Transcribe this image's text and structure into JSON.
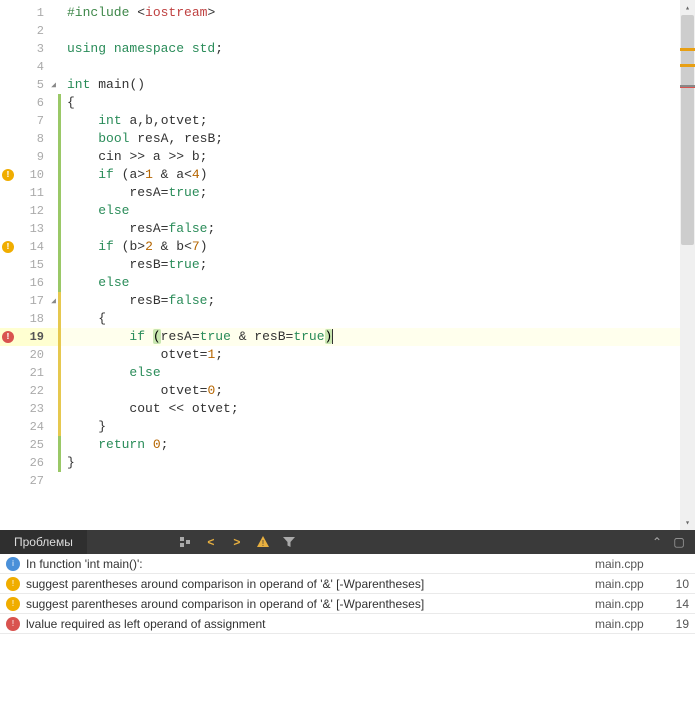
{
  "editor": {
    "lines": [
      {
        "n": 1,
        "segs": [
          [
            "pp",
            "#include "
          ],
          [
            "op",
            "<"
          ],
          [
            "ppval",
            "iostream"
          ],
          [
            "op",
            ">"
          ]
        ]
      },
      {
        "n": 2,
        "segs": []
      },
      {
        "n": 3,
        "segs": [
          [
            "kw",
            "using "
          ],
          [
            "kw",
            "namespace "
          ],
          [
            "type",
            "std"
          ],
          [
            "op",
            ";"
          ]
        ]
      },
      {
        "n": 4,
        "segs": []
      },
      {
        "n": 5,
        "segs": [
          [
            "type",
            "int "
          ],
          [
            "id",
            "main"
          ],
          [
            "op",
            "()"
          ]
        ],
        "fold": true
      },
      {
        "n": 6,
        "segs": [
          [
            "op",
            "{"
          ]
        ],
        "mod": "green"
      },
      {
        "n": 7,
        "segs": [
          [
            "id",
            "    "
          ],
          [
            "type",
            "int "
          ],
          [
            "id",
            "a"
          ],
          [
            "op",
            ","
          ],
          [
            "id",
            "b"
          ],
          [
            "op",
            ","
          ],
          [
            "id",
            "otvet"
          ],
          [
            "op",
            ";"
          ]
        ],
        "mod": "green"
      },
      {
        "n": 8,
        "segs": [
          [
            "id",
            "    "
          ],
          [
            "type",
            "bool "
          ],
          [
            "id",
            "resA"
          ],
          [
            "op",
            ", "
          ],
          [
            "id",
            "resB"
          ],
          [
            "op",
            ";"
          ]
        ],
        "mod": "green"
      },
      {
        "n": 9,
        "segs": [
          [
            "id",
            "    "
          ],
          [
            "id",
            "cin "
          ],
          [
            "op",
            ">> "
          ],
          [
            "id",
            "a "
          ],
          [
            "op",
            ">> "
          ],
          [
            "id",
            "b"
          ],
          [
            "op",
            ";"
          ]
        ],
        "mod": "green"
      },
      {
        "n": 10,
        "segs": [
          [
            "id",
            "    "
          ],
          [
            "kw",
            "if "
          ],
          [
            "op",
            "("
          ],
          [
            "id",
            "a"
          ],
          [
            "op",
            ">"
          ],
          [
            "num",
            "1"
          ],
          [
            "op",
            " & "
          ],
          [
            "id",
            "a"
          ],
          [
            "op",
            "<"
          ],
          [
            "num",
            "4"
          ],
          [
            "op",
            ")"
          ]
        ],
        "mod": "green",
        "gicon": "warn"
      },
      {
        "n": 11,
        "segs": [
          [
            "id",
            "        "
          ],
          [
            "id",
            "resA"
          ],
          [
            "op",
            "="
          ],
          [
            "bool",
            "true"
          ],
          [
            "op",
            ";"
          ]
        ],
        "mod": "green"
      },
      {
        "n": 12,
        "segs": [
          [
            "id",
            "    "
          ],
          [
            "kw",
            "else"
          ]
        ],
        "mod": "green"
      },
      {
        "n": 13,
        "segs": [
          [
            "id",
            "        "
          ],
          [
            "id",
            "resA"
          ],
          [
            "op",
            "="
          ],
          [
            "bool",
            "false"
          ],
          [
            "op",
            ";"
          ]
        ],
        "mod": "green"
      },
      {
        "n": 14,
        "segs": [
          [
            "id",
            "    "
          ],
          [
            "kw",
            "if "
          ],
          [
            "op",
            "("
          ],
          [
            "id",
            "b"
          ],
          [
            "op",
            ">"
          ],
          [
            "num",
            "2"
          ],
          [
            "op",
            " & "
          ],
          [
            "id",
            "b"
          ],
          [
            "op",
            "<"
          ],
          [
            "num",
            "7"
          ],
          [
            "op",
            ")"
          ]
        ],
        "mod": "green",
        "gicon": "warn"
      },
      {
        "n": 15,
        "segs": [
          [
            "id",
            "        "
          ],
          [
            "id",
            "resB"
          ],
          [
            "op",
            "="
          ],
          [
            "bool",
            "true"
          ],
          [
            "op",
            ";"
          ]
        ],
        "mod": "green"
      },
      {
        "n": 16,
        "segs": [
          [
            "id",
            "    "
          ],
          [
            "kw",
            "else"
          ]
        ],
        "mod": "green"
      },
      {
        "n": 17,
        "segs": [
          [
            "id",
            "        "
          ],
          [
            "id",
            "resB"
          ],
          [
            "op",
            "="
          ],
          [
            "bool",
            "false"
          ],
          [
            "op",
            ";"
          ]
        ],
        "mod": "yellow",
        "fold": true
      },
      {
        "n": 18,
        "segs": [
          [
            "id",
            "    "
          ],
          [
            "op",
            "{"
          ]
        ],
        "mod": "yellow"
      },
      {
        "n": 19,
        "segs": [
          [
            "id",
            "        "
          ],
          [
            "kw",
            "if "
          ],
          [
            "hp",
            "("
          ],
          [
            "id",
            "resA"
          ],
          [
            "op",
            "="
          ],
          [
            "bool",
            "true"
          ],
          [
            "op",
            " & "
          ],
          [
            "id",
            "resB"
          ],
          [
            "op",
            "="
          ],
          [
            "bool",
            "true"
          ],
          [
            "hp",
            ")"
          ],
          [
            "cur",
            "|"
          ]
        ],
        "mod": "yellow",
        "gicon": "err",
        "hl": true
      },
      {
        "n": 20,
        "segs": [
          [
            "id",
            "            "
          ],
          [
            "id",
            "otvet"
          ],
          [
            "op",
            "="
          ],
          [
            "num",
            "1"
          ],
          [
            "op",
            ";"
          ]
        ],
        "mod": "yellow"
      },
      {
        "n": 21,
        "segs": [
          [
            "id",
            "        "
          ],
          [
            "kw",
            "else"
          ]
        ],
        "mod": "yellow"
      },
      {
        "n": 22,
        "segs": [
          [
            "id",
            "            "
          ],
          [
            "id",
            "otvet"
          ],
          [
            "op",
            "="
          ],
          [
            "num",
            "0"
          ],
          [
            "op",
            ";"
          ]
        ],
        "mod": "yellow"
      },
      {
        "n": 23,
        "segs": [
          [
            "id",
            "        "
          ],
          [
            "id",
            "cout "
          ],
          [
            "op",
            "<< "
          ],
          [
            "id",
            "otvet"
          ],
          [
            "op",
            ";"
          ]
        ],
        "mod": "yellow"
      },
      {
        "n": 24,
        "segs": [
          [
            "id",
            "    "
          ],
          [
            "op",
            "}"
          ]
        ],
        "mod": "yellow"
      },
      {
        "n": 25,
        "segs": [
          [
            "id",
            "    "
          ],
          [
            "kw",
            "return "
          ],
          [
            "num",
            "0"
          ],
          [
            "op",
            ";"
          ]
        ],
        "mod": "green"
      },
      {
        "n": 26,
        "segs": [
          [
            "op",
            "}"
          ]
        ],
        "mod": "green"
      },
      {
        "n": 27,
        "segs": []
      }
    ]
  },
  "panel": {
    "tab": "Проблемы",
    "problems": [
      {
        "icon": "info",
        "msg": "In function 'int main()':",
        "file": "main.cpp",
        "line": ""
      },
      {
        "icon": "warn",
        "msg": "suggest parentheses around comparison in operand of '&' [-Wparentheses]",
        "file": "main.cpp",
        "line": "10"
      },
      {
        "icon": "warn",
        "msg": "suggest parentheses around comparison in operand of '&' [-Wparentheses]",
        "file": "main.cpp",
        "line": "14"
      },
      {
        "icon": "err",
        "msg": "lvalue required as left operand of assignment",
        "file": "main.cpp",
        "line": "19"
      }
    ]
  }
}
